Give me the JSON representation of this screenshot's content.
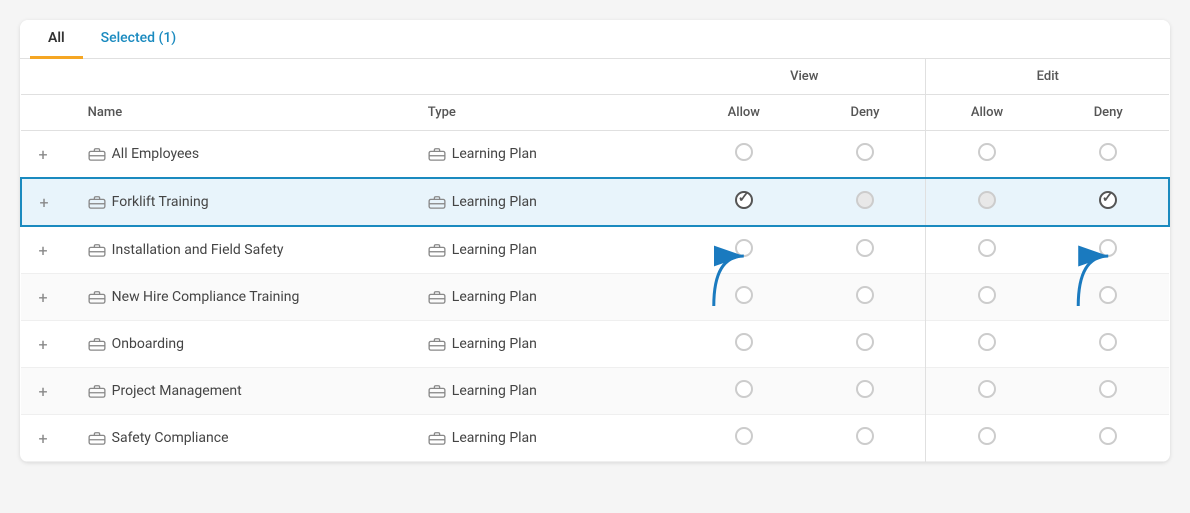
{
  "tabs": [
    {
      "id": "all",
      "label": "All",
      "active": true
    },
    {
      "id": "selected",
      "label": "Selected (1)",
      "active": false
    }
  ],
  "table": {
    "columns": {
      "expand": "",
      "name": "Name",
      "type": "Type",
      "view": "View",
      "edit": "Edit",
      "allow": "Allow",
      "deny": "Deny"
    },
    "rows": [
      {
        "id": 1,
        "name": "All Employees",
        "type": "Learning Plan",
        "viewAllow": "empty",
        "viewDeny": "empty",
        "editAllow": "empty",
        "editDeny": "empty",
        "highlighted": false
      },
      {
        "id": 2,
        "name": "Forklift Training",
        "type": "Learning Plan",
        "viewAllow": "checked",
        "viewDeny": "half",
        "editAllow": "half",
        "editDeny": "checked",
        "highlighted": true
      },
      {
        "id": 3,
        "name": "Installation and Field Safety",
        "type": "Learning Plan",
        "viewAllow": "empty",
        "viewDeny": "empty",
        "editAllow": "empty",
        "editDeny": "empty",
        "highlighted": false
      },
      {
        "id": 4,
        "name": "New Hire Compliance Training",
        "type": "Learning Plan",
        "viewAllow": "empty",
        "viewDeny": "empty",
        "editAllow": "empty",
        "editDeny": "empty",
        "highlighted": false
      },
      {
        "id": 5,
        "name": "Onboarding",
        "type": "Learning Plan",
        "viewAllow": "empty",
        "viewDeny": "empty",
        "editAllow": "empty",
        "editDeny": "empty",
        "highlighted": false
      },
      {
        "id": 6,
        "name": "Project Management",
        "type": "Learning Plan",
        "viewAllow": "empty",
        "viewDeny": "empty",
        "editAllow": "empty",
        "editDeny": "empty",
        "highlighted": false
      },
      {
        "id": 7,
        "name": "Safety Compliance",
        "type": "Learning Plan",
        "viewAllow": "empty",
        "viewDeny": "empty",
        "editAllow": "empty",
        "editDeny": "empty",
        "highlighted": false
      }
    ]
  },
  "arrows": {
    "view_allow": {
      "label": "View Allow arrow"
    },
    "edit_deny": {
      "label": "Edit Deny arrow"
    }
  }
}
